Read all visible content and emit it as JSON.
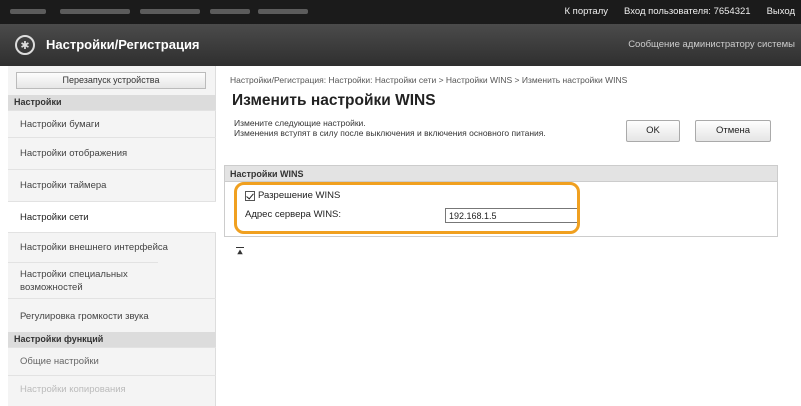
{
  "top_bar": {
    "portal_link": "К порталу",
    "login_label": "Вход пользователя:",
    "user_id": "7654321",
    "logout": "Выход"
  },
  "header": {
    "title": "Настройки/Регистрация",
    "admin_message": "Сообщение администратору системы"
  },
  "sidebar": {
    "restart_button": "Перезапуск устройства",
    "sections": [
      "Настройки",
      "Настройки функций"
    ],
    "items": [
      "Настройки бумаги",
      "Настройки отображения",
      "Настройки таймера",
      "Настройки сети",
      "Настройки внешнего интерфейса",
      "Настройки специальных возможностей",
      "Регулировка громкости звука",
      "Общие настройки",
      "Настройки копирования"
    ]
  },
  "main": {
    "breadcrumb": "Настройки/Регистрация: Настройки: Настройки сети > Настройки WINS > Изменить настройки WINS",
    "title": "Изменить настройки WINS",
    "description_line1": "Измените следующие настройки.",
    "description_line2": "Изменения вступят в силу после выключения и включения основного питания.",
    "ok_button": "OK",
    "cancel_button": "Отмена",
    "panel_title": "Настройки WINS",
    "wins_checkbox_label": "Разрешение WINS",
    "wins_checkbox_checked": true,
    "wins_server_label": "Адрес сервера WINS:",
    "wins_server_value": "192.168.1.5"
  },
  "colors": {
    "highlight": "#f0a020",
    "header_bg": "#3a3a3a"
  }
}
